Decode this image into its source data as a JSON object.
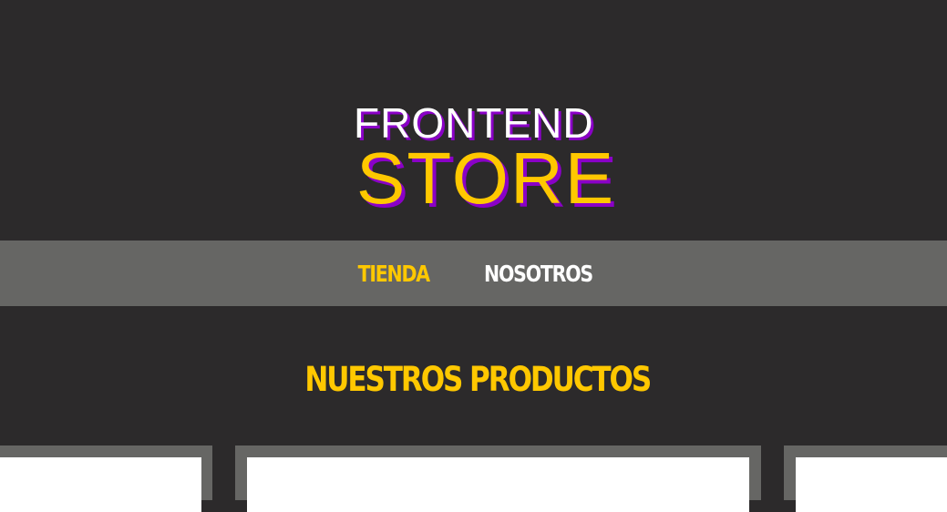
{
  "brand": {
    "line1": "FRONTEND",
    "line2": "STORE",
    "colors": {
      "primary": "#ffc800",
      "shadow": "#8a00c7",
      "background": "#2c2a2b",
      "nav_background": "#666664"
    }
  },
  "nav": {
    "items": [
      {
        "label": "TIENDA",
        "active": true
      },
      {
        "label": "NOSOTROS",
        "active": false
      }
    ]
  },
  "main": {
    "section_title": "NUESTROS PRODUCTOS"
  }
}
